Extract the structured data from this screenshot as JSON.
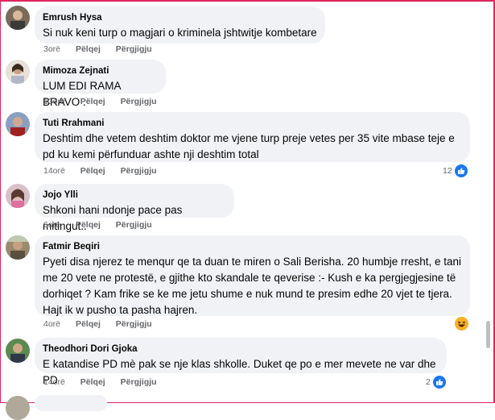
{
  "comments": [
    {
      "author": "Emrush Hysa",
      "text": "Si nuk keni turp o magjari o kriminela jshtwitje kombetare",
      "time": "3orë",
      "like_label": "Pëlqej",
      "reply_label": "Përgjigju"
    },
    {
      "author": "Mimoza Zejnati",
      "text": "LUM EDI RAMA BRAVO .",
      "time": "13orë",
      "like_label": "Pëlqej",
      "reply_label": "Përgjigju"
    },
    {
      "author": "Tuti Rrahmani",
      "text": "Deshtim dhe vetem deshtim doktor me vjene turp preje vetes per 35 vite mbase teje e pd ku kemi përfunduar ashte nji deshtim total",
      "time": "14orë",
      "like_label": "Pëlqej",
      "reply_label": "Përgjigju",
      "reaction_count": "12"
    },
    {
      "author": "Jojo Ylli",
      "text": "Shkoni hani ndonje pace pas mitingut..",
      "time": "6orë",
      "like_label": "Pëlqej",
      "reply_label": "Përgjigju"
    },
    {
      "author": "Fatmir Beqiri",
      "text": "Pyeti disa njerez te menqur qe ta duan te miren o Sali Berisha. 20 humbje rresht, e tani me 20 vete ne protestë, e gjithe kto skandale te qeverise :- Kush e ka pergjegjesine të dorhiqet ? Kam frike se ke me jetu shume e nuk mund te presim edhe 20 vjet te tjera. Hajt ik w pusho ta pasha hajren.",
      "time": "4orë",
      "like_label": "Pëlqej",
      "reply_label": "Përgjigju",
      "reaction": "haha"
    },
    {
      "author": "Theodhori Dori Gjoka",
      "text": "E katandise PD mè pak se nje klas shkolle. Duket qe po e mer mevete ne var dhe PD",
      "time": "14orë",
      "like_label": "Pëlqej",
      "reply_label": "Përgjigju",
      "reaction_count": "2"
    }
  ],
  "colors": {
    "bubble": "#f0f2f5",
    "like_blue": "#1877f2",
    "meta_grey": "#65676b",
    "frame": "#e0245e"
  }
}
